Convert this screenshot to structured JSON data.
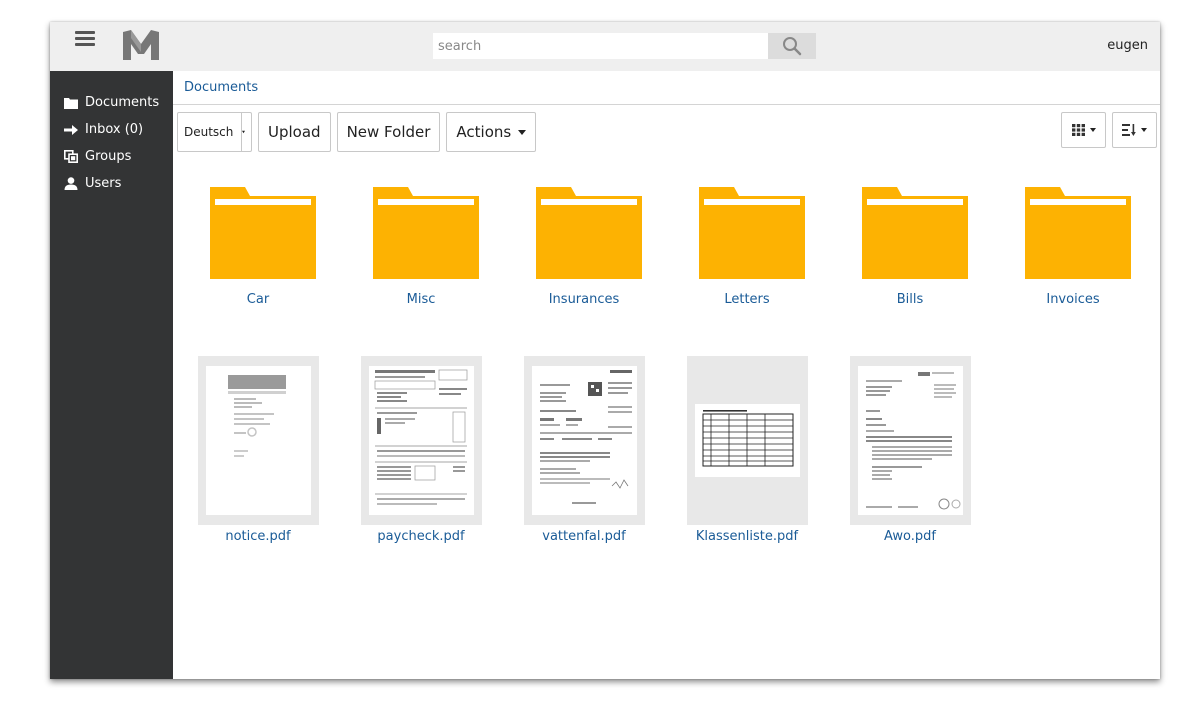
{
  "header": {
    "search_placeholder": "search",
    "username": "eugen"
  },
  "sidebar": {
    "items": [
      {
        "label": "Documents",
        "icon": "folder-icon"
      },
      {
        "label": "Inbox (0)",
        "icon": "arrow-right-icon"
      },
      {
        "label": "Groups",
        "icon": "groups-icon"
      },
      {
        "label": "Users",
        "icon": "user-icon"
      }
    ]
  },
  "breadcrumb": {
    "current": "Documents"
  },
  "toolbar": {
    "language": "Deutsch",
    "upload_label": "Upload",
    "new_folder_label": "New Folder",
    "actions_label": "Actions"
  },
  "folders": [
    {
      "name": "Car"
    },
    {
      "name": "Misc"
    },
    {
      "name": "Insurances"
    },
    {
      "name": "Letters"
    },
    {
      "name": "Bills"
    },
    {
      "name": "Invoices"
    }
  ],
  "documents": [
    {
      "name": "notice.pdf"
    },
    {
      "name": "paycheck.pdf"
    },
    {
      "name": "vattenfal.pdf"
    },
    {
      "name": "Klassenliste.pdf"
    },
    {
      "name": "Awo.pdf"
    }
  ],
  "colors": {
    "folder": "#fdb202",
    "link": "#1a5b97",
    "sidebar": "#333435",
    "topbar": "#efefef"
  }
}
